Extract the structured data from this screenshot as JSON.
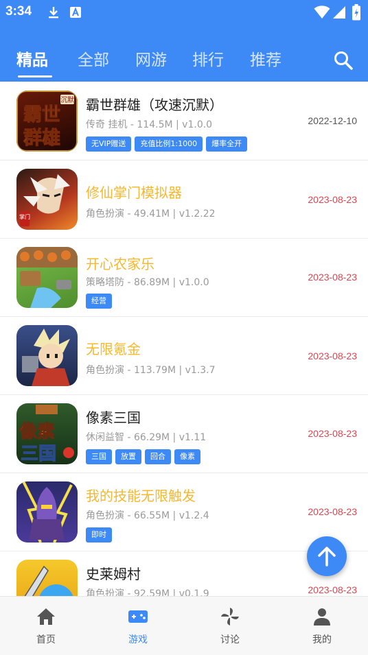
{
  "status_bar": {
    "time": "3:34"
  },
  "tabs": [
    {
      "label": "精品",
      "active": true
    },
    {
      "label": "全部",
      "active": false
    },
    {
      "label": "网游",
      "active": false
    },
    {
      "label": "排行",
      "active": false
    },
    {
      "label": "推荐",
      "active": false
    }
  ],
  "games": [
    {
      "name": "霸世群雄（攻速沉默）",
      "name_color": "#222222",
      "meta": "传奇 挂机 - 114.5M | v1.0.0",
      "date": "2022-12-10",
      "date_color": "#555555",
      "tags": [
        "无VIP赠送",
        "充值比例1:1000",
        "爆率全开"
      ],
      "icon_text": "霸世群雄",
      "icon_badge": "沉默"
    },
    {
      "name": "修仙掌门模拟器",
      "name_color": "#f5b82e",
      "meta": "角色扮演 - 49.41M | v1.2.22",
      "date": "2023-08-23",
      "date_color": "#e0454f",
      "tags": [],
      "icon_text": "",
      "icon_badge": "掌门"
    },
    {
      "name": "开心农家乐",
      "name_color": "#f5b82e",
      "meta": "策略塔防 - 86.89M | v1.0.0",
      "date": "2023-08-23",
      "date_color": "#e0454f",
      "tags": [
        "经营"
      ],
      "icon_text": "",
      "icon_badge": ""
    },
    {
      "name": "无限氪金",
      "name_color": "#f5b82e",
      "meta": "角色扮演 - 113.79M | v1.3.7",
      "date": "2023-08-23",
      "date_color": "#e0454f",
      "tags": [],
      "icon_text": "",
      "icon_badge": ""
    },
    {
      "name": "像素三国",
      "name_color": "#222222",
      "meta": "休闲益智 - 66.29M | v1.11",
      "date": "2023-08-23",
      "date_color": "#e0454f",
      "tags": [
        "三国",
        "放置",
        "回合",
        "像素"
      ],
      "icon_text": "像素三国",
      "icon_badge": ""
    },
    {
      "name": "我的技能无限触发",
      "name_color": "#f5b82e",
      "meta": "角色扮演 - 66.55M | v1.2.4",
      "date": "2023-08-23",
      "date_color": "#e0454f",
      "tags": [
        "即时"
      ],
      "icon_text": "",
      "icon_badge": ""
    },
    {
      "name": "史莱姆村",
      "name_color": "#222222",
      "meta": "角色扮演 - 92.59M | v0.1.9",
      "date": "2023-08-23",
      "date_color": "#e0454f",
      "tags": [],
      "icon_text": "",
      "icon_badge": ""
    }
  ],
  "bottom_nav": [
    {
      "label": "首页",
      "icon": "home-icon",
      "active": false
    },
    {
      "label": "游戏",
      "icon": "gamepad-icon",
      "active": true
    },
    {
      "label": "讨论",
      "icon": "pinwheel-icon",
      "active": false
    },
    {
      "label": "我的",
      "icon": "person-icon",
      "active": false
    }
  ],
  "colors": {
    "primary": "#3d8af7",
    "highlight_name": "#f5b82e",
    "date_red": "#e0454f"
  }
}
